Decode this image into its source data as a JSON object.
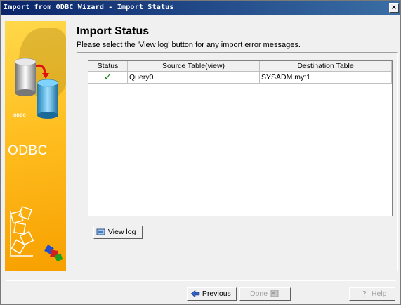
{
  "window": {
    "title": "Import from ODBC Wizard - Import Status",
    "close_glyph": "×"
  },
  "banner": {
    "brand": "ODBC",
    "small_label": "ODBC"
  },
  "header": {
    "title": "Import Status",
    "subtitle": "Please select the 'View log' button for any import error messages."
  },
  "table": {
    "columns": [
      "Status",
      "Source Table(view)",
      "Destination Table"
    ],
    "rows": [
      {
        "status": "✓",
        "source": "Query0",
        "destination": "SYSADM.myt1"
      }
    ]
  },
  "buttons": {
    "view_log": {
      "label_prefix": "",
      "mnemonic": "V",
      "label_rest": "iew log"
    },
    "previous": {
      "mnemonic": "P",
      "label_rest": "revious"
    },
    "done": {
      "label": "Done"
    },
    "help": {
      "mnemonic": "H",
      "label_rest": "elp"
    }
  },
  "colors": {
    "titlebar": "#0a246a",
    "banner": "#ffbe20",
    "check": "#008000"
  }
}
